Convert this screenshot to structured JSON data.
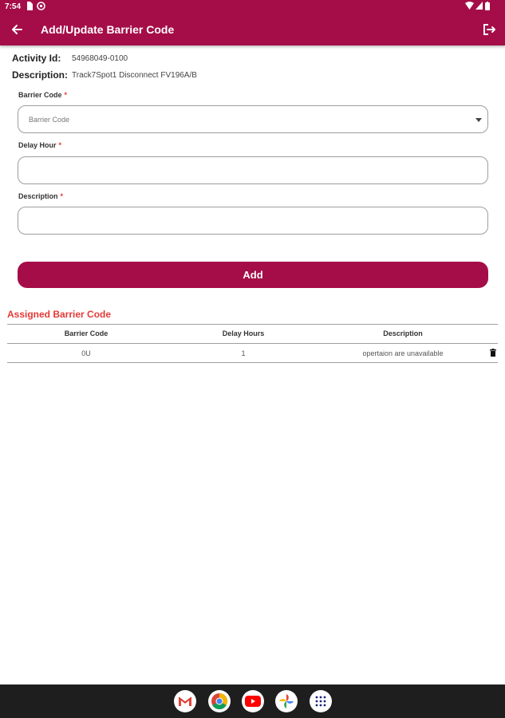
{
  "status_bar": {
    "time": "7:54"
  },
  "app_bar": {
    "title": "Add/Update Barrier Code"
  },
  "info": {
    "activity_id_label": "Activity Id:",
    "activity_id_value": "54968049-0100",
    "description_label": "Description:",
    "description_value": "Track7Spot1 Disconnect FV196A/B"
  },
  "form": {
    "barrier_code_label": "Barrier Code",
    "barrier_code_placeholder": "Barrier Code",
    "delay_hour_label": "Delay Hour",
    "description_label": "Description",
    "required_mark": "*",
    "add_button": "Add"
  },
  "assigned": {
    "title": "Assigned Barrier Code",
    "columns": [
      "Barrier Code",
      "Delay Hours",
      "Description"
    ],
    "rows": [
      {
        "barrier_code": "0U",
        "delay_hours": "1",
        "description": "opertaion are unavailable"
      }
    ]
  },
  "dock": {
    "apps": [
      "gmail-icon",
      "chrome-icon",
      "youtube-icon",
      "photos-icon",
      "app-drawer-icon"
    ]
  },
  "colors": {
    "brand": "#a50d48",
    "accent_red": "#e53935"
  }
}
